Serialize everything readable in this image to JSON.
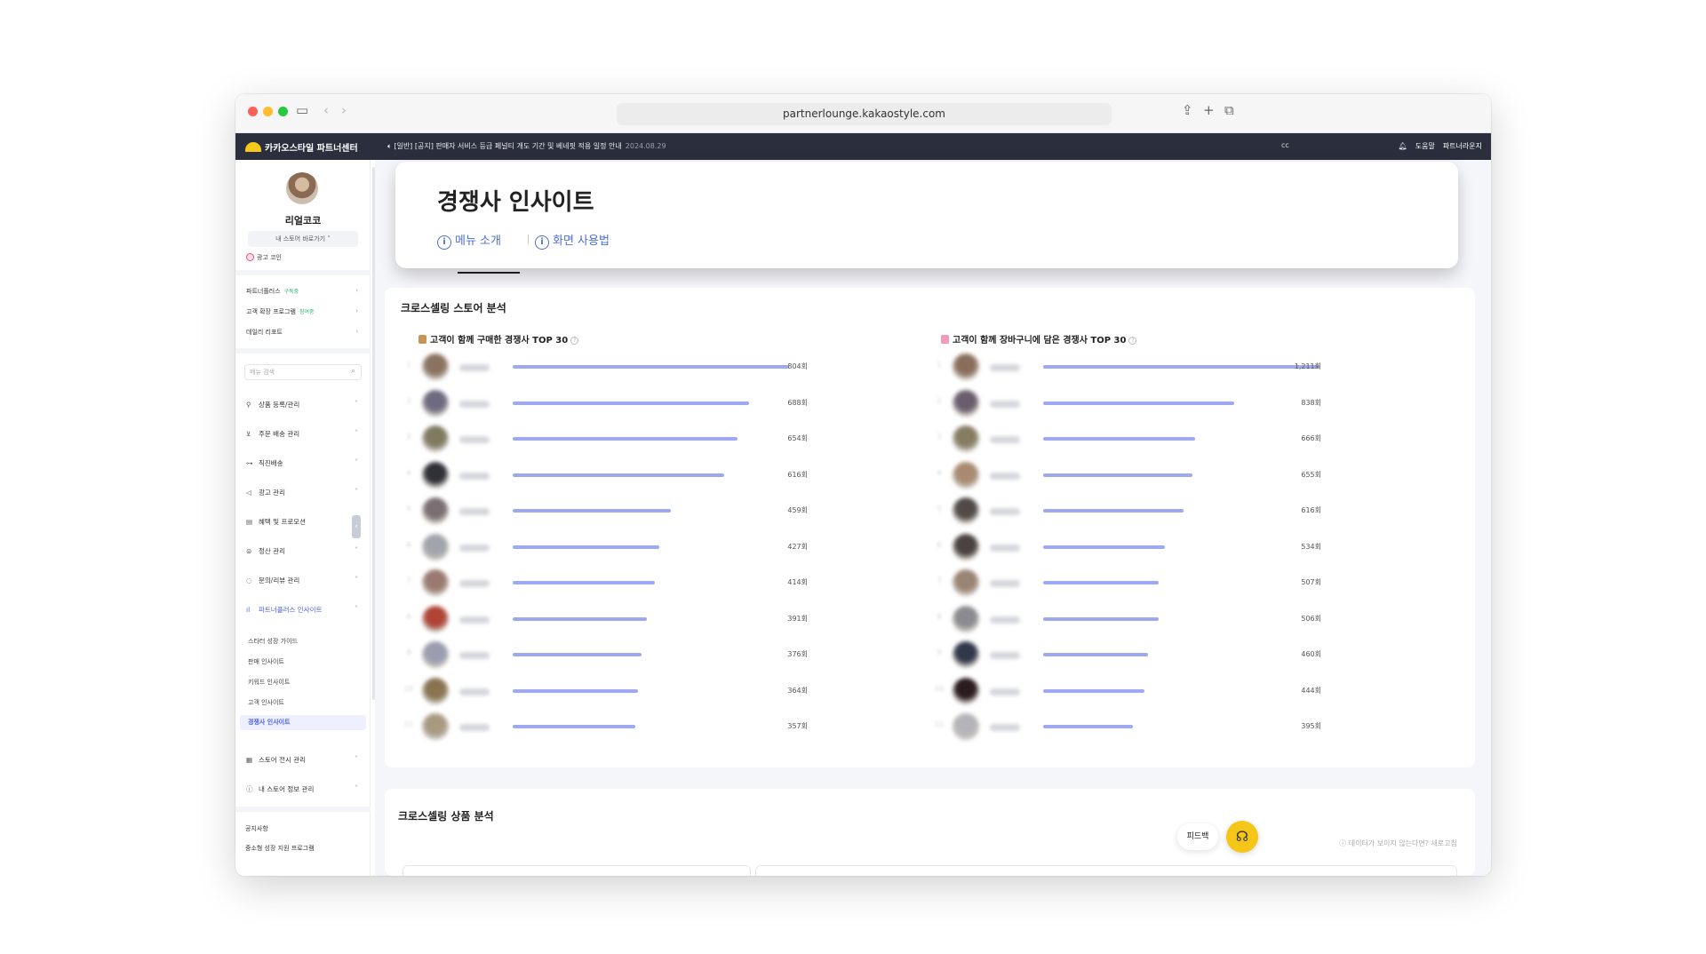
{
  "browser": {
    "url": "partnerlounge.kakaostyle.com"
  },
  "topnav": {
    "brand": "카카오스타일 파트너센터",
    "notice": "[일반] [공지] 판매자 서비스 등급 페널티 개도 기간 및 베네핏 적용 일정 안내",
    "notice_date": "2024.08.29",
    "mid_text": "cc",
    "help": "도움말",
    "lounge": "파트너라운지"
  },
  "sidebar": {
    "store_name": "리얼코코",
    "store_button": "내 스토어 바로가기 ˅",
    "coin": "광고 코인",
    "links": [
      {
        "label": "파트너플러스",
        "tag": "구독중"
      },
      {
        "label": "고객 확장 프로그램",
        "tag": "참여중"
      },
      {
        "label": "데일리 리포트",
        "tag": ""
      }
    ],
    "search_placeholder": "메뉴 검색",
    "menu": [
      {
        "label": "상품 등록/관리",
        "icon": "shirt-icon"
      },
      {
        "label": "주문 배송 관리",
        "icon": "cart-icon"
      },
      {
        "label": "직진배송",
        "icon": "truck-icon"
      },
      {
        "label": "광고 관리",
        "icon": "megaphone-icon"
      },
      {
        "label": "혜택 및 프로모션",
        "icon": "ticket-icon"
      },
      {
        "label": "정산 관리",
        "icon": "won-icon"
      },
      {
        "label": "문의/리뷰 관리",
        "icon": "chat-icon"
      },
      {
        "label": "파트너플러스 인사이트",
        "icon": "chart-icon"
      }
    ],
    "submenu": [
      "스타터 성장 가이드",
      "판매 인사이트",
      "키워드 인사이트",
      "고객 인사이트",
      "경쟁사 인사이트"
    ],
    "menu_bottom": [
      {
        "label": "스토어 전시 관리",
        "icon": "layout-icon"
      },
      {
        "label": "내 스토어 정보 관리",
        "icon": "info-icon"
      }
    ],
    "footer": [
      "공지사항",
      "중소형 성장 지원 프로그램"
    ]
  },
  "header": {
    "title": "경쟁사 인사이트",
    "link_menu_intro": "메뉴 소개",
    "link_usage": "화면 사용법"
  },
  "cross_store": {
    "title": "크로스셀링 스토어 분석",
    "left_title": "고객이 함께 구매한 경쟁사 TOP 30",
    "right_title": "고객이 함께 장바구니에 담은 경쟁사 TOP 30",
    "left_counts": [
      "804회",
      "688회",
      "654회",
      "616회",
      "459회",
      "427회",
      "414회",
      "391회",
      "376회",
      "364회",
      "357회"
    ],
    "right_counts": [
      "1,211회",
      "838회",
      "666회",
      "655회",
      "616회",
      "534회",
      "507회",
      "506회",
      "460회",
      "444회",
      "395회"
    ],
    "left_values": [
      804,
      688,
      654,
      616,
      459,
      427,
      414,
      391,
      376,
      364,
      357
    ],
    "right_values": [
      1211,
      838,
      666,
      655,
      616,
      534,
      507,
      506,
      460,
      444,
      395
    ],
    "left_thumb_colors": [
      "#8a7260",
      "#6e6a80",
      "#807a60",
      "#303038",
      "#7a6e72",
      "#a0a4ac",
      "#9a7a70",
      "#b04436",
      "#9a9cb0",
      "#8a7450",
      "#a89a80"
    ],
    "right_thumb_colors": [
      "#8a6e5c",
      "#6a5e6e",
      "#857c62",
      "#a88a70",
      "#504a48",
      "#4a4240",
      "#9a8474",
      "#8a8a90",
      "#30384a",
      "#2a1c20",
      "#b4b4b8"
    ]
  },
  "cross_product": {
    "title": "크로스셀링 상품 분석",
    "hint": "ⓘ 데이터가 보이지 않는다면? 새로고침"
  },
  "floating": {
    "feedback": "피드백"
  },
  "colors": {
    "bar": "#9daaf2",
    "accent": "#4b63e4",
    "nav_bg": "#2b2f3d"
  }
}
